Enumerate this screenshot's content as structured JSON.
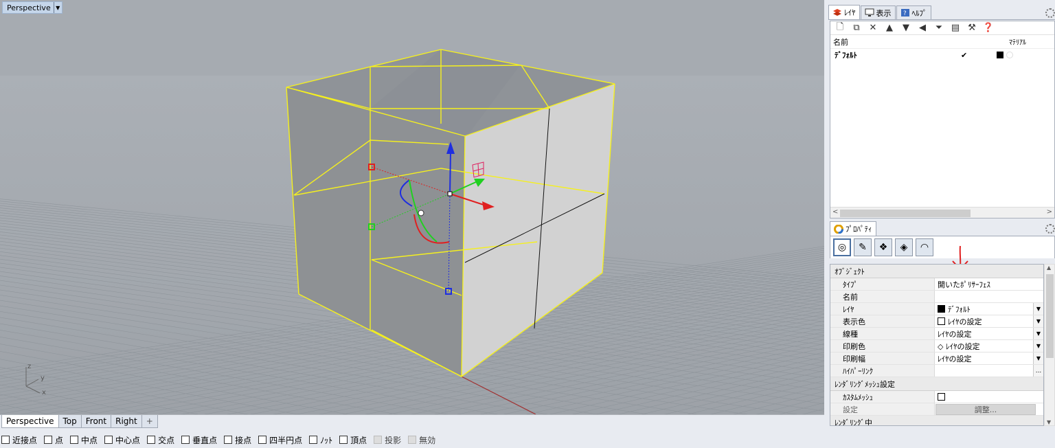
{
  "viewport": {
    "title": "Perspective",
    "axes": {
      "z": "z",
      "y": "y",
      "x": "x"
    }
  },
  "viewport_tabs": [
    {
      "label": "Perspective",
      "active": true
    },
    {
      "label": "Top"
    },
    {
      "label": "Front"
    },
    {
      "label": "Right"
    },
    {
      "label": "+"
    }
  ],
  "osnaps": [
    {
      "label": "近接点"
    },
    {
      "label": "点"
    },
    {
      "label": "中点"
    },
    {
      "label": "中心点"
    },
    {
      "label": "交点"
    },
    {
      "label": "垂直点"
    },
    {
      "label": "接点"
    },
    {
      "label": "四半円点"
    },
    {
      "label": "ﾉｯﾄ"
    },
    {
      "label": "頂点"
    },
    {
      "label": "投影",
      "disabled": true
    },
    {
      "label": "無効",
      "disabled": true
    }
  ],
  "layer_panel": {
    "tabs": [
      {
        "label": "ﾚｲﾔ",
        "icon": "layers-icon",
        "active": true
      },
      {
        "label": "表示",
        "icon": "display-icon"
      },
      {
        "label": "ﾍﾙﾌﾟ",
        "icon": "help-icon"
      }
    ],
    "columns": {
      "name": "名前",
      "material": "ﾏﾃﾘｱﾙ"
    },
    "rows": [
      {
        "name": "ﾃﾞﾌｫﾙﾄ",
        "current": "✔"
      }
    ]
  },
  "properties_panel": {
    "tab_label": "ﾌﾟﾛﾊﾟﾃｨ",
    "sections": {
      "object": "ｵﾌﾞｼﾞｪｸﾄ",
      "render_mesh": "ﾚﾝﾀﾞﾘﾝｸﾞﾒｯｼｭ設定",
      "render_more": "ﾚﾝﾀﾞﾘﾝｸﾞ中"
    },
    "rows": {
      "type": {
        "key": "ﾀｲﾌﾟ",
        "value": "開いたﾎﾟﾘｻｰﾌｪｽ"
      },
      "name": {
        "key": "名前",
        "value": ""
      },
      "layer": {
        "key": "ﾚｲﾔ",
        "value": "ﾃﾞﾌｫﾙﾄ"
      },
      "display_color": {
        "key": "表示色",
        "value": "ﾚｲﾔの設定"
      },
      "linetype": {
        "key": "線種",
        "value": "ﾚｲﾔの設定"
      },
      "print_color": {
        "key": "印刷色",
        "value": "◇ ﾚｲﾔの設定"
      },
      "print_width": {
        "key": "印刷幅",
        "value": "ﾚｲﾔの設定"
      },
      "hyperlink": {
        "key": "ﾊｲﾊﾟｰﾘﾝｸ",
        "value": "..."
      },
      "custom_mesh": {
        "key": "ｶｽﾀﾑﾒｯｼｭ"
      },
      "settings": {
        "key": "設定",
        "value": "調整..."
      }
    }
  },
  "colors": {
    "viewport_bg": "#a0a5ab",
    "selection": "#f5f01e",
    "annotation_arrow": "#e02020"
  }
}
